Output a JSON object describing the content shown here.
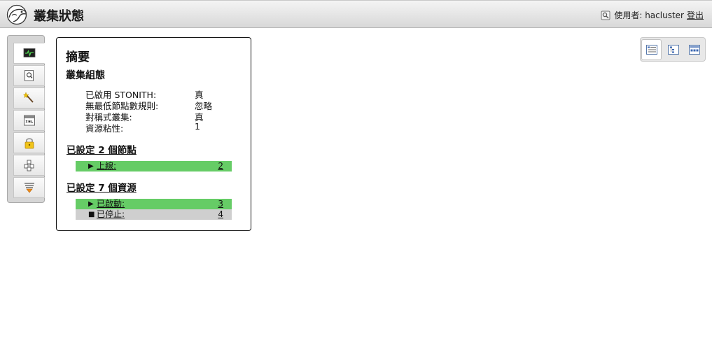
{
  "header": {
    "title": "叢集狀態",
    "user_label": "使用者: hacluster",
    "logout_label": "登出"
  },
  "sidebar": {
    "items": [
      {
        "name": "dashboard",
        "icon": "monitor-icon",
        "active": true
      },
      {
        "name": "history",
        "icon": "magnifier-document-icon",
        "active": false
      },
      {
        "name": "tools",
        "icon": "wand-icon",
        "active": false
      },
      {
        "name": "config",
        "icon": "xml-icon",
        "active": false
      },
      {
        "name": "access",
        "icon": "lock-icon",
        "active": false
      },
      {
        "name": "wizards",
        "icon": "cubes-icon",
        "active": false
      },
      {
        "name": "batch",
        "icon": "filter-icon",
        "active": false
      }
    ]
  },
  "summary": {
    "title": "摘要",
    "config_title": "叢集組態",
    "properties": [
      {
        "key": "已啟用 STONITH:",
        "value": "真"
      },
      {
        "key": "無最低節點數規則:",
        "value": "忽略"
      },
      {
        "key": "對稱式叢集:",
        "value": "真"
      },
      {
        "key": "資源粘性:",
        "value": "1"
      }
    ],
    "nodes_title": "已設定 2 個節點",
    "nodes": [
      {
        "marker": "▶",
        "label": "上線:",
        "count": "2"
      }
    ],
    "resources_title": "已設定 7 個資源",
    "resources": [
      {
        "marker": "▶",
        "label": "已啟動:",
        "count": "3"
      },
      {
        "marker": "■",
        "label": "已停止:",
        "count": "4"
      }
    ]
  },
  "colors": {
    "online_green": "#66cc66",
    "stopped_grey": "#cfcfcf"
  },
  "views": [
    {
      "name": "summary-view",
      "icon": "list-view-icon",
      "active": true
    },
    {
      "name": "tree-view",
      "icon": "tree-view-icon",
      "active": false
    },
    {
      "name": "grid-view",
      "icon": "grid-view-icon",
      "active": false
    }
  ]
}
